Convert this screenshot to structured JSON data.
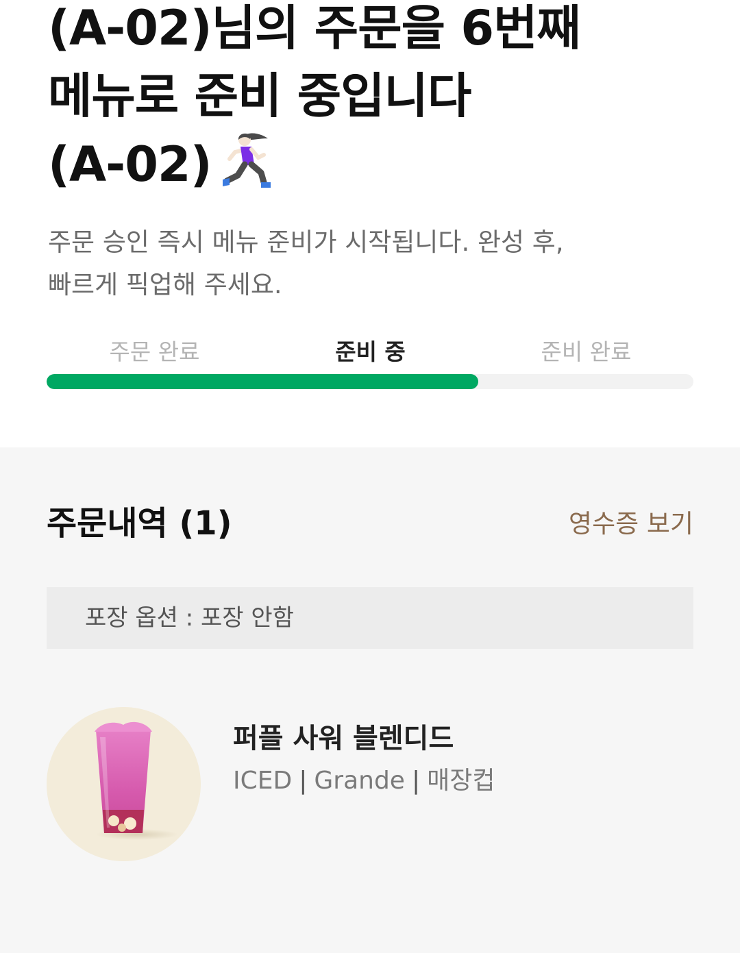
{
  "header": {
    "title_lines": [
      " (A-02)님의 주문을 6번째",
      "메뉴로 준비 중입니다",
      "(A-02)"
    ],
    "title_icon": "running-woman-icon"
  },
  "subtitle_lines": [
    "주문 승인 즉시 메뉴 준비가 시작됩니다. 완성 후,",
    "빠르게 픽업해 주세요."
  ],
  "steps": [
    {
      "label": "주문 완료",
      "state": "done"
    },
    {
      "label": "준비 중",
      "state": "current"
    },
    {
      "label": "준비 완료",
      "state": "pending"
    }
  ],
  "progress": {
    "fraction": 0.667,
    "color": "#00a862"
  },
  "order": {
    "title": "주문내역 (1)",
    "receipt_link": "영수증 보기",
    "packaging_option": "포장 옵션 : 포장 안함",
    "items": [
      {
        "name": "퍼플 사워 블렌디드",
        "options": [
          "ICED",
          "Grande",
          "매장컵"
        ],
        "separator": "|",
        "thumbnail_icon": "purple-blended-drink-icon"
      }
    ]
  },
  "colors": {
    "accent_green": "#00a862",
    "link_brown": "#8a6a4d",
    "section_bg": "#f6f6f6",
    "option_bg": "#ececec"
  }
}
